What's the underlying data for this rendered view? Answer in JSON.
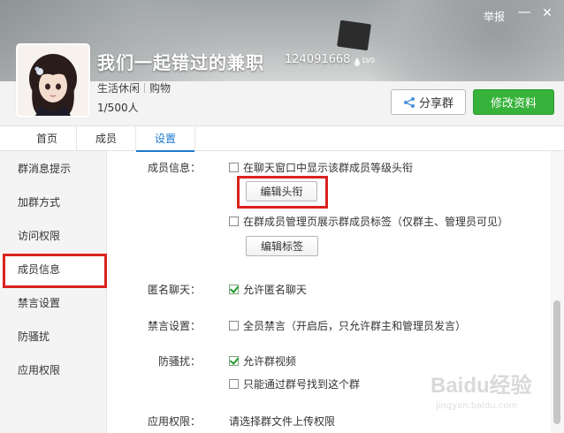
{
  "header": {
    "report_label": "举报",
    "minimize_glyph": "—",
    "close_glyph": "✕",
    "group_name": "我们一起错过的兼职",
    "group_id": "124091668",
    "level_badge": "LV0",
    "tags": [
      "生活休闲",
      "购物"
    ],
    "member_count": "1/500人",
    "share_button": "分享群",
    "edit_button": "修改资料",
    "accent_color": "#37b23a"
  },
  "tabs": [
    {
      "label": "首页"
    },
    {
      "label": "成员"
    },
    {
      "label": "设置",
      "active": true
    }
  ],
  "sidebar": {
    "items": [
      {
        "label": "群消息提示"
      },
      {
        "label": "加群方式"
      },
      {
        "label": "访问权限"
      },
      {
        "label": "成员信息",
        "active": true
      },
      {
        "label": "禁言设置"
      },
      {
        "label": "防骚扰"
      },
      {
        "label": "应用权限"
      }
    ]
  },
  "settings": {
    "member_info": {
      "label": "成员信息：",
      "option1": {
        "text": "在聊天窗口中显示该群成员等级头衔",
        "checked": false
      },
      "edit_title_button": "编辑头衔",
      "option2": {
        "text": "在群成员管理页展示群成员标签（仅群主、管理员可见）",
        "checked": false
      },
      "edit_tag_button": "编辑标签"
    },
    "anonymous": {
      "label": "匿名聊天：",
      "option": {
        "text": "允许匿名聊天",
        "checked": true
      }
    },
    "mute": {
      "label": "禁言设置：",
      "option": {
        "text": "全员禁言（开启后，只允许群主和管理员发言）",
        "checked": false
      }
    },
    "anti_harass": {
      "label": "防骚扰：",
      "option1": {
        "text": "允许群视频",
        "checked": true
      },
      "option2": {
        "text": "只能通过群号找到这个群",
        "checked": false
      }
    },
    "app_permission": {
      "label": "应用权限：",
      "text": "请选择群文件上传权限"
    }
  },
  "watermark": {
    "text": "Baidu经验",
    "sub": "jingyan.baidu.com"
  }
}
